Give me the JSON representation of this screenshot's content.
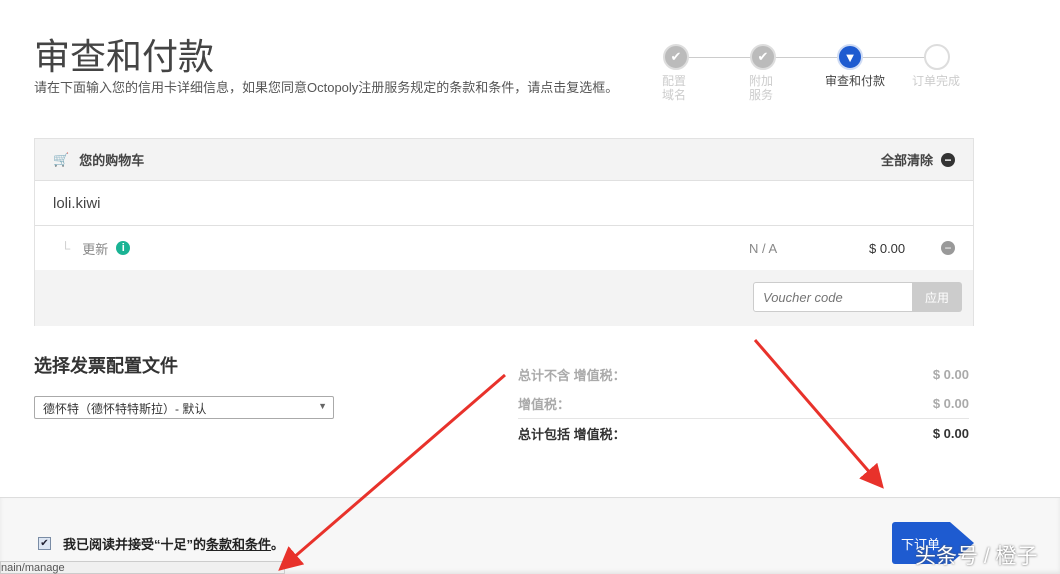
{
  "header": {
    "title": "审查和付款",
    "description": "请在下面输入您的信用卡详细信息，如果您同意Octopoly注册服务规定的条款和条件，请点击复选框。"
  },
  "steps": [
    {
      "label": "配置\n域名",
      "state": "done"
    },
    {
      "label": "附加\n服务",
      "state": "done"
    },
    {
      "label": "审查和付款",
      "state": "active"
    },
    {
      "label": "订单完成",
      "state": "todo"
    }
  ],
  "cart": {
    "title": "您的购物车",
    "clear_all": "全部清除",
    "domain": "loli.kiwi",
    "item": {
      "label": "更新",
      "term": "N / A",
      "price": "$ 0.00"
    },
    "voucher_placeholder": "Voucher code",
    "apply": "应用"
  },
  "billing": {
    "title": "选择发票配置文件",
    "selected": "德怀特（德怀特特斯拉）- 默认"
  },
  "totals": [
    {
      "label": "总计不含 增值税：",
      "value": "$ 0.00"
    },
    {
      "label": "增值税：",
      "value": "$ 0.00"
    },
    {
      "label": "总计包括 增值税：",
      "value": "$ 0.00"
    }
  ],
  "footer": {
    "agree_prefix": "我已阅读并接受“十足”的",
    "terms_link": "条款和条件",
    "agree_suffix": "。",
    "order_button": "下订单",
    "status_url": "nain/manage"
  },
  "watermark": "头条号 / 橙子",
  "colors": {
    "accent": "#1e5bd0",
    "info": "#1ab394",
    "arrow": "#e8322b"
  }
}
